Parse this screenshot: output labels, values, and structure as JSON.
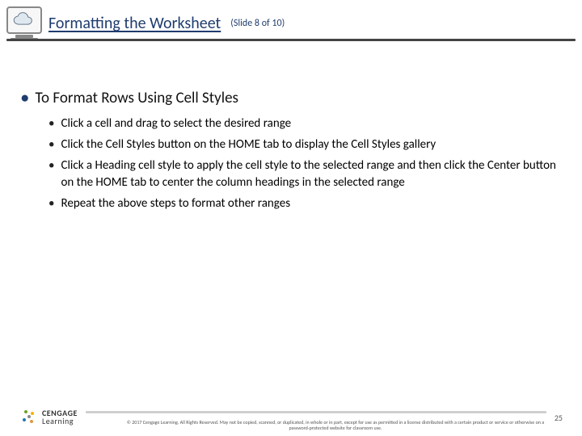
{
  "header": {
    "title": "Formatting the Worksheet",
    "slide_label": "(Slide 8 of 10)"
  },
  "body": {
    "top_point": "To Format Rows Using Cell Styles",
    "subs": [
      "Click a cell and drag to select the desired range",
      "Click the Cell Styles button on the HOME tab to display the Cell Styles gallery",
      "Click a Heading cell style to apply the cell style to the selected range and then click the Center button on the HOME tab to center the column headings in the selected range",
      "Repeat the above steps to format other ranges"
    ]
  },
  "footer": {
    "brand_line1": "CENGAGE",
    "brand_line2": "Learning",
    "copyright": "© 2017 Cengage Learning. All Rights Reserved. May not be copied, scanned, or duplicated, in whole or in part, except for use as permitted in a license distributed with a certain product or service or otherwise on a password-protected website for classroom use.",
    "page_number": "25"
  }
}
